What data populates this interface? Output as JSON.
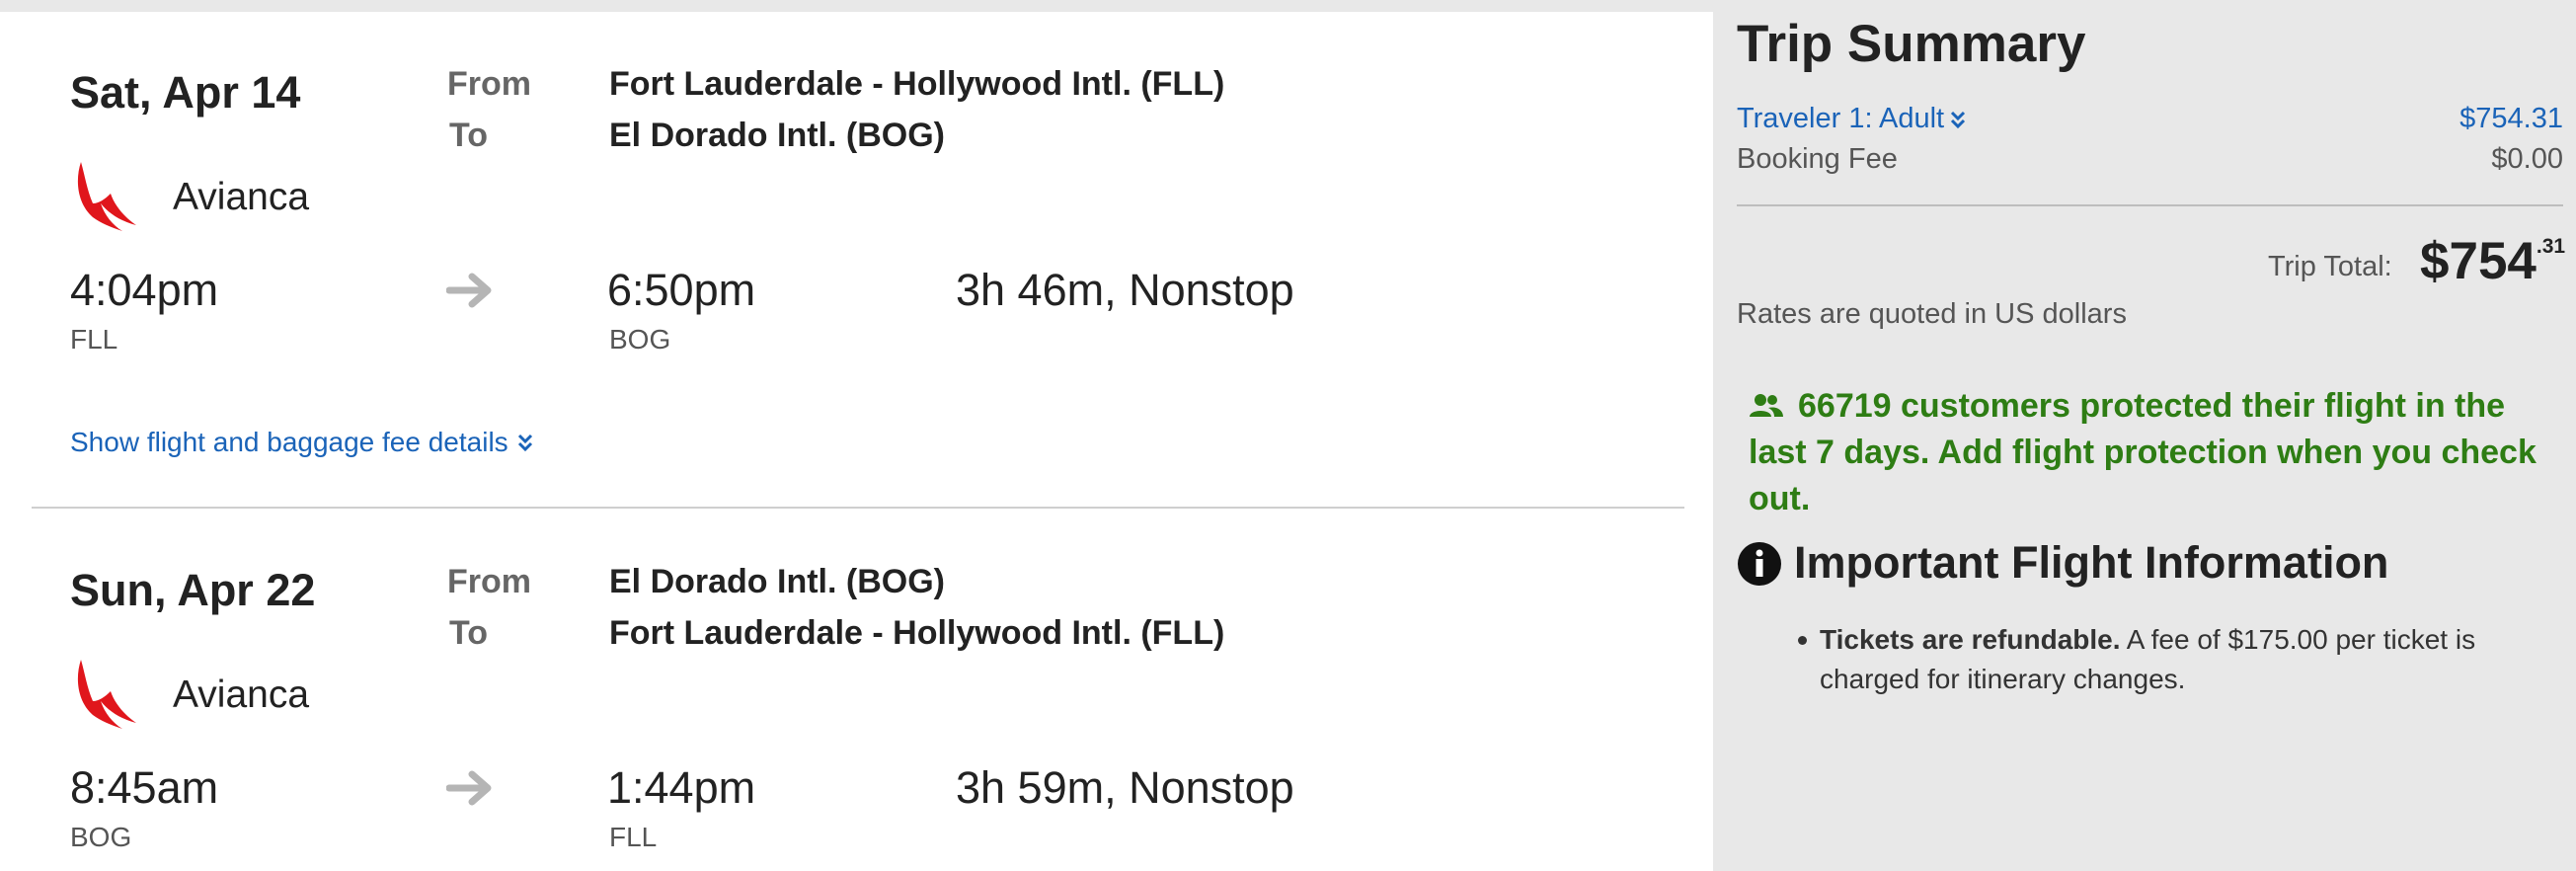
{
  "flights": [
    {
      "date": "Sat, Apr 14",
      "from_label": "From",
      "to_label": "To",
      "from_airport": "Fort Lauderdale - Hollywood Intl. (FLL)",
      "to_airport": "El Dorado Intl. (BOG)",
      "airline": "Avianca",
      "depart_time": "4:04pm",
      "depart_code": "FLL",
      "arrive_time": "6:50pm",
      "arrive_code": "BOG",
      "duration": "3h 46m, Nonstop",
      "details_link": "Show flight and baggage fee details"
    },
    {
      "date": "Sun, Apr 22",
      "from_label": "From",
      "to_label": "To",
      "from_airport": "El Dorado Intl. (BOG)",
      "to_airport": "Fort Lauderdale - Hollywood Intl. (FLL)",
      "airline": "Avianca",
      "depart_time": "8:45am",
      "depart_code": "BOG",
      "arrive_time": "1:44pm",
      "arrive_code": "FLL",
      "duration": "3h 59m, Nonstop"
    }
  ],
  "summary": {
    "title": "Trip Summary",
    "traveler_label": "Traveler 1: Adult",
    "traveler_price": "$754.31",
    "fee_label": "Booking Fee",
    "fee_price": "$0.00",
    "total_label": "Trip Total:",
    "total_dollars": "$754",
    "total_cents": ".31",
    "currency_note": "Rates are quoted in US dollars",
    "promo_text": "66719 customers protected their flight in the last 7 days. Add flight protection when you check out."
  },
  "info": {
    "title": "Important Flight Information",
    "bullet_bold": "Tickets are refundable.",
    "bullet_text": " A fee of $175.00 per ticket is charged for itinerary changes."
  },
  "colors": {
    "link": "#1a63b8",
    "promo": "#2e7d14",
    "airline_logo": "#e0161c"
  },
  "icons": {
    "airline_logo": "avianca-logo",
    "arrow": "arrow-right-icon",
    "expand": "double-chevron-down-icon",
    "promo": "users-icon",
    "info": "info-circle-icon"
  }
}
